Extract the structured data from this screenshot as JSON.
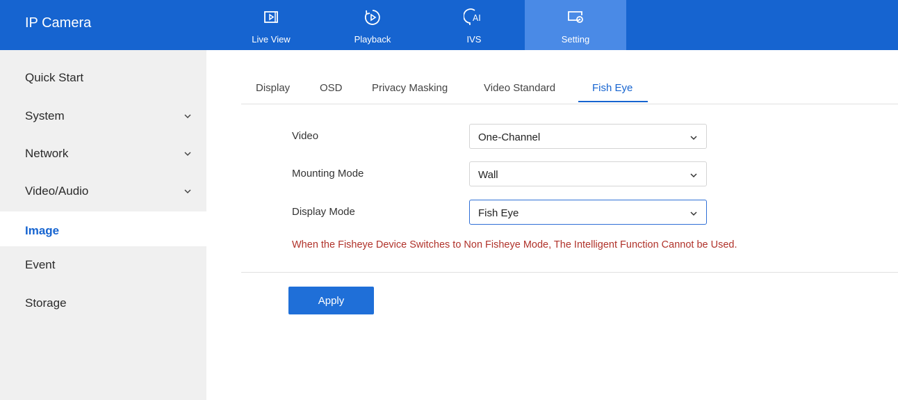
{
  "app": {
    "title": "IP Camera"
  },
  "topnav": [
    {
      "label": "Live View",
      "icon": "live-view-icon"
    },
    {
      "label": "Playback",
      "icon": "playback-icon"
    },
    {
      "label": "IVS",
      "icon": "ivs-ai-icon"
    },
    {
      "label": "Setting",
      "icon": "setting-icon",
      "active": true
    }
  ],
  "sidebar": {
    "items": [
      {
        "label": "Quick Start"
      },
      {
        "label": "System",
        "expandable": true
      },
      {
        "label": "Network",
        "expandable": true
      },
      {
        "label": "Video/Audio",
        "expandable": true
      },
      {
        "label": "Image",
        "active": true
      },
      {
        "label": "Event"
      },
      {
        "label": "Storage"
      }
    ]
  },
  "tabs": [
    {
      "label": "Display"
    },
    {
      "label": "OSD"
    },
    {
      "label": "Privacy Masking"
    },
    {
      "label": "Video Standard"
    },
    {
      "label": "Fish Eye",
      "active": true
    }
  ],
  "form": {
    "video": {
      "label": "Video",
      "value": "One-Channel"
    },
    "mounting_mode": {
      "label": "Mounting Mode",
      "value": "Wall"
    },
    "display_mode": {
      "label": "Display Mode",
      "value": "Fish Eye"
    }
  },
  "warning": "When the Fisheye Device Switches to Non Fisheye Mode, The Intelligent Function Cannot be Used.",
  "apply_label": "Apply",
  "colors": {
    "header": "#1664d0",
    "active_nav": "#4a8ae6",
    "accent": "#1664d0",
    "warning": "#b0322a",
    "sidebar_bg": "#f0f0f0"
  }
}
